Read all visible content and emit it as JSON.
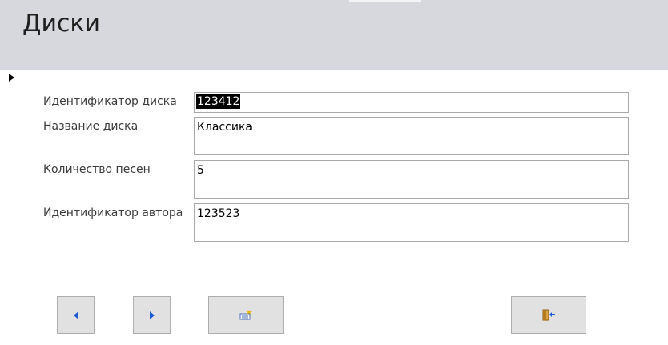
{
  "form": {
    "title": "Диски"
  },
  "fields": [
    {
      "label": "Идентификатор диска",
      "value": "123412"
    },
    {
      "label": "Название диска",
      "value": "Классика"
    },
    {
      "label": "Количество песен",
      "value": "5"
    },
    {
      "label": "Идентификатор автора",
      "value": "123523"
    }
  ],
  "buttons": {
    "prev_icon": "triangle-left-icon",
    "next_icon": "triangle-right-icon",
    "new_icon": "new-record-icon",
    "exit_icon": "exit-door-icon"
  },
  "colors": {
    "header_bg": "#d6d8de",
    "button_bg": "#e1e1e1",
    "nav_arrow": "#1e5ad6"
  }
}
